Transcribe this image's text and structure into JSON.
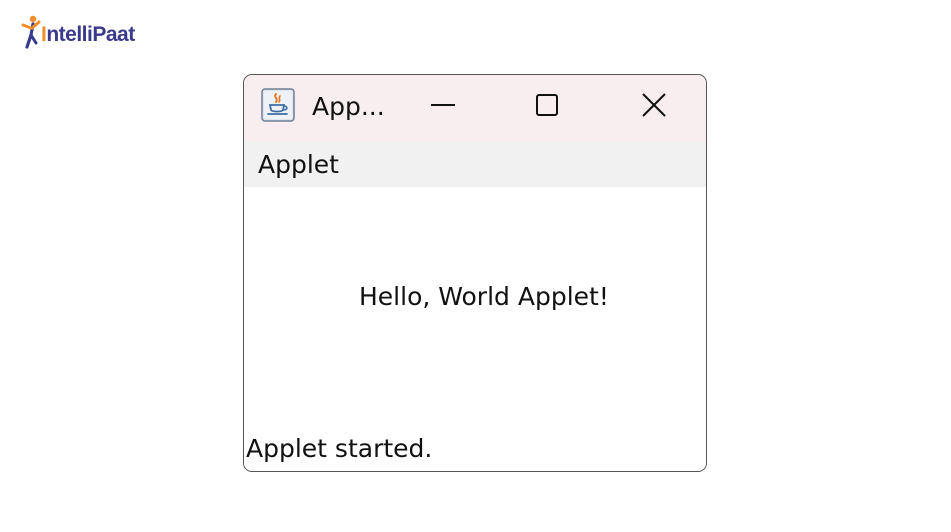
{
  "logo": {
    "text_main": "ntelliPaat",
    "text_accent": "I",
    "primary_color": "#3a3a8c",
    "accent_color": "#f28c28"
  },
  "window": {
    "title": "App...",
    "icon": "java-coffee-icon",
    "controls": {
      "minimize": "minimize-icon",
      "maximize": "maximize-icon",
      "close": "close-icon"
    },
    "titlebar_color": "#f9eeef"
  },
  "menubar": {
    "items": [
      {
        "label": "Applet"
      }
    ]
  },
  "applet": {
    "message": "Hello, World Applet!",
    "status": "Applet started."
  }
}
